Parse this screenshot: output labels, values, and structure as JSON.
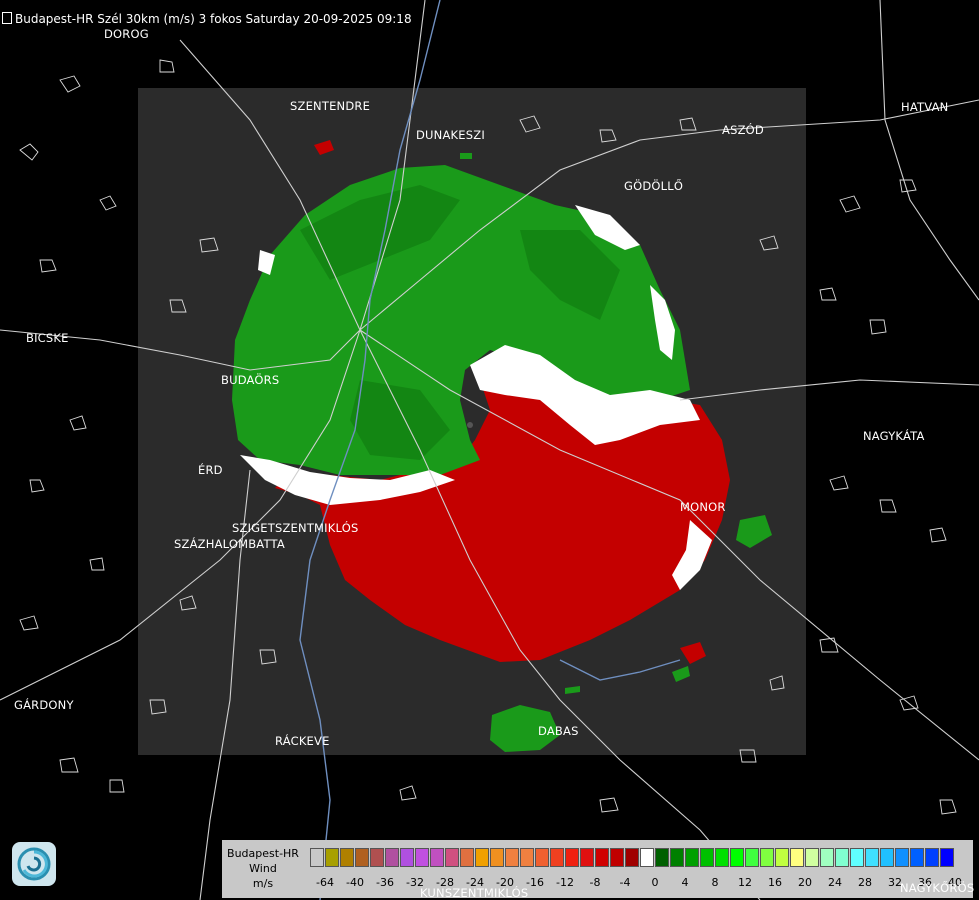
{
  "header": {
    "title": "Budapest-HR Szél 30km (m/s) 3 fokos Saturday 20-09-2025 09:18"
  },
  "cities": [
    {
      "name": "DOROG"
    },
    {
      "name": "SZENTENDRE"
    },
    {
      "name": "DUNAKESZI"
    },
    {
      "name": "ASZÓD"
    },
    {
      "name": "HATVAN"
    },
    {
      "name": "GÖDÖLLŐ"
    },
    {
      "name": "BICSKE"
    },
    {
      "name": "BUDAÖRS"
    },
    {
      "name": "NAGYKÁTA"
    },
    {
      "name": "ÉRD"
    },
    {
      "name": "MONOR"
    },
    {
      "name": "SZIGETSZENTMIKLÓS"
    },
    {
      "name": "SZÁZHALOMBATTA"
    },
    {
      "name": "GÁRDONY"
    },
    {
      "name": "RÁCKEVE"
    },
    {
      "name": "DABAS"
    },
    {
      "name": "KUNSZENTMIKLÓS"
    },
    {
      "name": "NAGYKŐRÖS"
    }
  ],
  "legend": {
    "line1": "Budapest-HR",
    "line2": "Wind",
    "line3": "m/s",
    "ticks": [
      "-64",
      "-40",
      "-36",
      "-32",
      "-28",
      "-24",
      "-20",
      "-16",
      "-12",
      "-8",
      "-4",
      "0",
      "4",
      "8",
      "12",
      "16",
      "20",
      "24",
      "28",
      "32",
      "36",
      "40"
    ],
    "colors": [
      "#c8c8c8",
      "#a8a000",
      "#b08000",
      "#b06020",
      "#b05050",
      "#b050a0",
      "#b050e0",
      "#c050e0",
      "#c050c0",
      "#d05080",
      "#e07040",
      "#f0a000",
      "#f09020",
      "#f08040",
      "#f08040",
      "#f06030",
      "#f04020",
      "#f02010",
      "#e01010",
      "#d00000",
      "#c00000",
      "#a00000",
      "#ffffff",
      "#006000",
      "#008000",
      "#00a000",
      "#00c000",
      "#00e000",
      "#00ff00",
      "#40ff40",
      "#80ff40",
      "#c0ff40",
      "#ffff80",
      "#d0ffa0",
      "#a0ffc0",
      "#80ffd0",
      "#60ffff",
      "#40e0ff",
      "#20c0ff",
      "#1090ff",
      "#0060ff",
      "#0040ff",
      "#0000ff"
    ]
  }
}
